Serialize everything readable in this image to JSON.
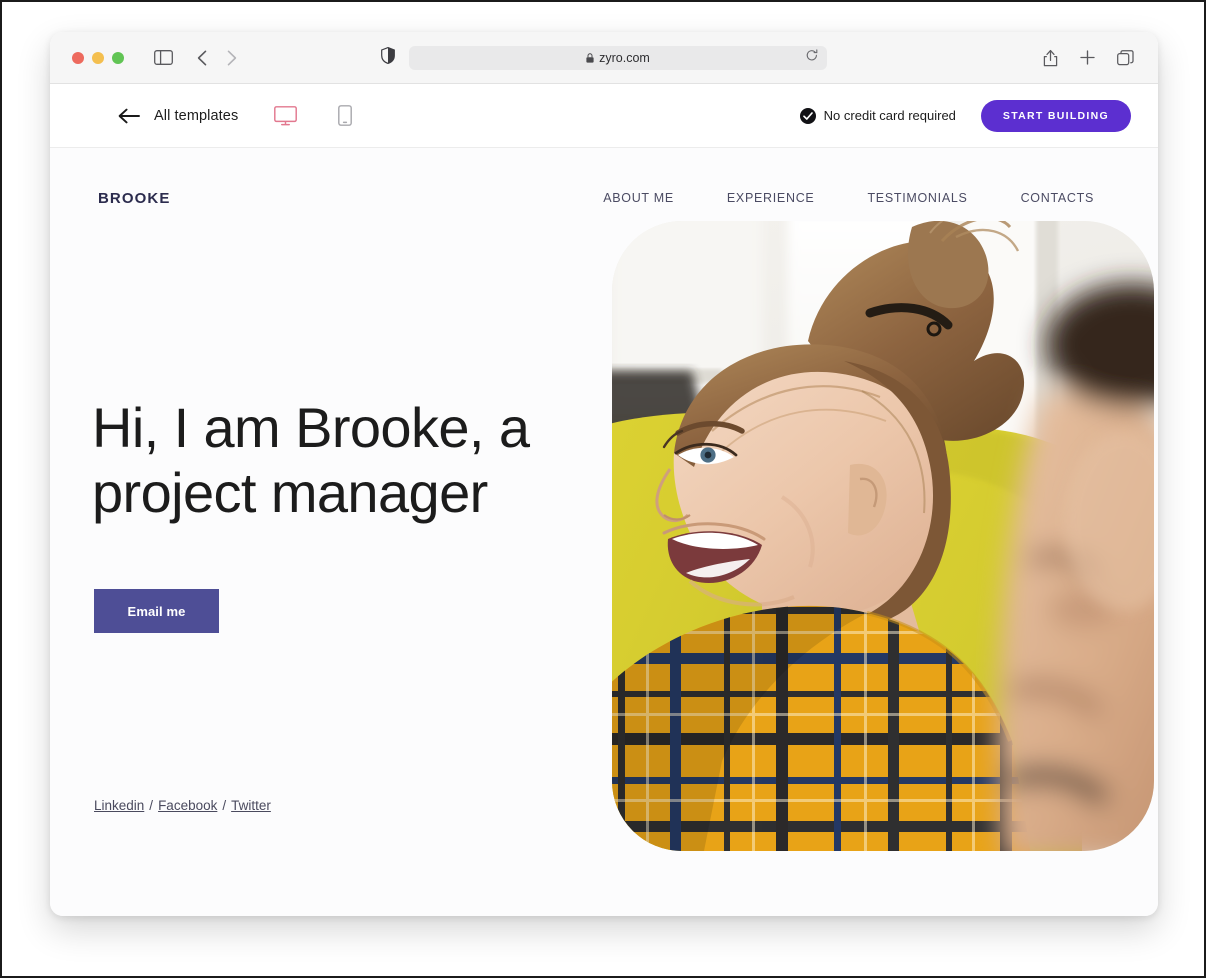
{
  "browser": {
    "url": "zyro.com",
    "lock_icon": "lock-icon",
    "reload_icon": "reload-icon",
    "shield_icon": "privacy-shield-icon",
    "sidebar_icon": "sidebar-toggle-icon",
    "back_icon": "back-arrow-icon",
    "forward_icon": "forward-arrow-icon",
    "share_icon": "share-icon",
    "newtab_icon": "plus-icon",
    "tabs_icon": "tab-overview-icon",
    "traffic_lights": [
      "close",
      "minimize",
      "maximize"
    ]
  },
  "template_bar": {
    "back_label": "All templates",
    "back_icon": "arrow-left-icon",
    "desktop_icon": "desktop-monitor-icon",
    "mobile_icon": "mobile-phone-icon",
    "active_device": "desktop",
    "no_credit_card": "No credit card required",
    "check_icon": "check-circle-icon",
    "cta_label": "START BUILDING",
    "cta_color": "#5c2fd0",
    "active_device_color": "#e2788f"
  },
  "site": {
    "logo": "BROOKE",
    "logo_color": "#2c2c4e",
    "nav": [
      {
        "label": "ABOUT ME"
      },
      {
        "label": "EXPERIENCE"
      },
      {
        "label": "TESTIMONIALS"
      },
      {
        "label": "CONTACTS"
      }
    ],
    "hero": {
      "title": "Hi, I am Brooke, a project manager",
      "button_label": "Email me",
      "button_color": "#4e4e96",
      "photo_alt": "laughing-woman-yellow-plaid-shirt-photo"
    },
    "social": {
      "items": [
        {
          "label": "Linkedin"
        },
        {
          "label": "Facebook"
        },
        {
          "label": "Twitter"
        }
      ],
      "separator": "/"
    }
  }
}
